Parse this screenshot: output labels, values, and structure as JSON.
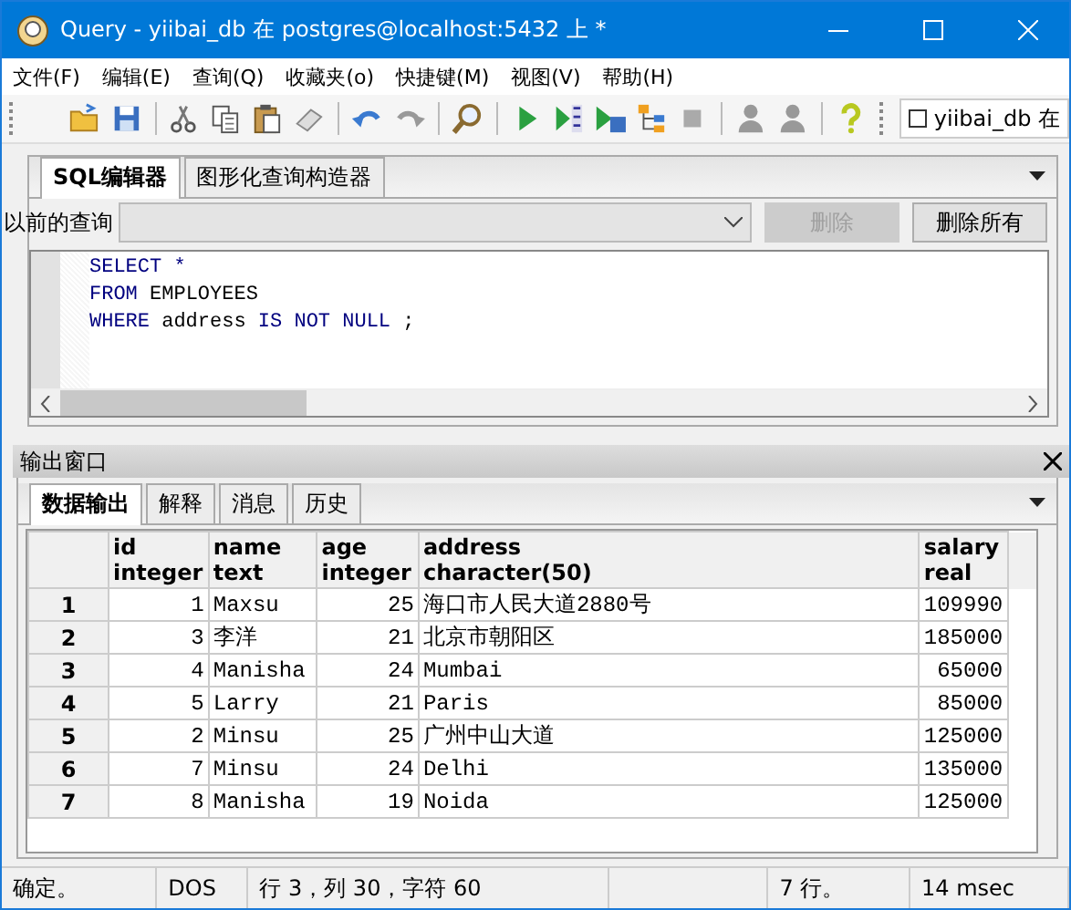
{
  "window": {
    "title": "Query - yiibai_db 在  postgres@localhost:5432 上 *"
  },
  "menu": [
    "文件(F)",
    "编辑(E)",
    "查询(Q)",
    "收藏夹(o)",
    "快捷键(M)",
    "视图(V)",
    "帮助(H)"
  ],
  "toolbar": {
    "database": {
      "label": "yiibai_db 在",
      "checked": false
    }
  },
  "editor_tabs": [
    {
      "label": "SQL编辑器",
      "selected": true
    },
    {
      "label": "图形化查询构造器",
      "selected": false
    }
  ],
  "previous_queries": {
    "label": "以前的查询",
    "buttons": [
      {
        "label": "删除",
        "disabled": true
      },
      {
        "label": "删除所有",
        "disabled": false
      }
    ]
  },
  "sql": [
    [
      {
        "text": "SELECT *",
        "kind": "keyword"
      }
    ],
    [
      {
        "text": "FROM ",
        "kind": "keyword"
      },
      {
        "text": "EMPLOYEES",
        "kind": "text"
      }
    ],
    [
      {
        "text": "WHERE ",
        "kind": "keyword"
      },
      {
        "text": "address ",
        "kind": "text"
      },
      {
        "text": "IS NOT NULL",
        "kind": "keyword"
      },
      {
        "text": " ;",
        "kind": "text"
      }
    ]
  ],
  "output": {
    "title": "输出窗口",
    "tabs": [
      {
        "label": "数据输出",
        "selected": true
      },
      {
        "label": "解释",
        "selected": false
      },
      {
        "label": "消息",
        "selected": false
      },
      {
        "label": "历史",
        "selected": false
      }
    ],
    "columns": [
      {
        "name": "id",
        "type": "integer",
        "kind": "number"
      },
      {
        "name": "name",
        "type": "text",
        "kind": "text"
      },
      {
        "name": "age",
        "type": "integer",
        "kind": "number"
      },
      {
        "name": "address",
        "type": "character(50)",
        "kind": "text"
      },
      {
        "name": "salary",
        "type": "real",
        "kind": "number"
      }
    ],
    "rows": [
      {
        "num": "1",
        "cells": [
          "1",
          "Maxsu",
          "25",
          "海口市人民大道2880号",
          "109990"
        ]
      },
      {
        "num": "2",
        "cells": [
          "3",
          "李洋",
          "21",
          "北京市朝阳区",
          "185000"
        ]
      },
      {
        "num": "3",
        "cells": [
          "4",
          "Manisha",
          "24",
          "Mumbai",
          "65000"
        ]
      },
      {
        "num": "4",
        "cells": [
          "5",
          "Larry",
          "21",
          "Paris",
          "85000"
        ]
      },
      {
        "num": "5",
        "cells": [
          "2",
          "Minsu",
          "25",
          "广州中山大道",
          "125000"
        ]
      },
      {
        "num": "6",
        "cells": [
          "7",
          "Minsu",
          "24",
          "Delhi",
          "135000"
        ]
      },
      {
        "num": "7",
        "cells": [
          "8",
          "Manisha",
          "19",
          "Noida",
          "125000"
        ]
      }
    ]
  },
  "status_bar": [
    "确定。",
    "DOS",
    "行 3，列 30，字符 60",
    "7 行。",
    "14 msec"
  ]
}
